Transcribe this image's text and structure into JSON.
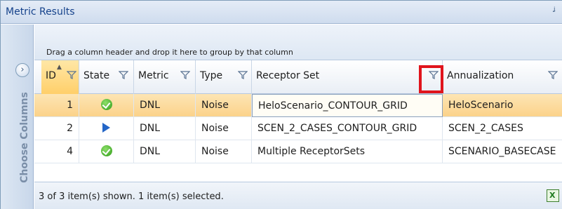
{
  "window": {
    "title": "Metric Results",
    "pin_glyph": "ᶨ"
  },
  "sidebar": {
    "expander_glyph": "›",
    "label": "Choose Columns"
  },
  "group_panel": {
    "hint": "Drag a column header and drop it here to group by that column"
  },
  "columns": [
    {
      "key": "id",
      "label": "ID"
    },
    {
      "key": "state",
      "label": "State"
    },
    {
      "key": "metric",
      "label": "Metric"
    },
    {
      "key": "type",
      "label": "Type"
    },
    {
      "key": "receptor_set",
      "label": "Receptor Set"
    },
    {
      "key": "annualization",
      "label": "Annualization"
    }
  ],
  "rows": [
    {
      "id": "1",
      "state": "complete",
      "metric": "DNL",
      "type": "Noise",
      "receptor_set": "HeloScenario_CONTOUR_GRID",
      "annualization": "HeloScenario",
      "selected": true
    },
    {
      "id": "2",
      "state": "running",
      "metric": "DNL",
      "type": "Noise",
      "receptor_set": "SCEN_2_CASES_CONTOUR_GRID",
      "annualization": "SCEN_2_CASES",
      "selected": false
    },
    {
      "id": "4",
      "state": "complete",
      "metric": "DNL",
      "type": "Noise",
      "receptor_set": "Multiple ReceptorSets",
      "annualization": "SCENARIO_BASECASE",
      "selected": false
    }
  ],
  "status": {
    "text": "3 of 3 item(s) shown. 1 item(s) selected."
  },
  "colors": {
    "accent_highlight": "#e0141c",
    "selected_row": "#fbd28a",
    "header_text": "#15428b"
  }
}
